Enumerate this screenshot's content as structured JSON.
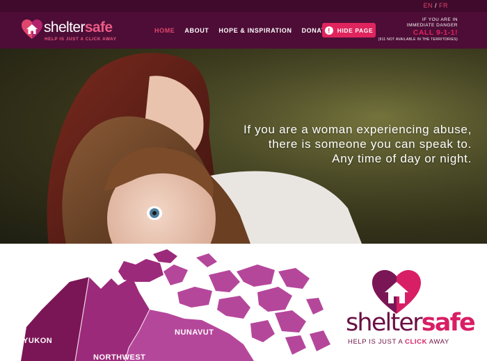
{
  "language": {
    "en": "EN",
    "separator": "/",
    "fr": "FR"
  },
  "brand": {
    "name_part1": "shelter",
    "name_part2": "safe",
    "tagline": "HELP IS JUST A CLICK AWAY",
    "big_tagline_part1": "HELP IS JUST A ",
    "big_tagline_click": "CLICK",
    "big_tagline_part2": " AWAY"
  },
  "nav": {
    "items": [
      {
        "label": "HOME",
        "active": true
      },
      {
        "label": "ABOUT",
        "active": false
      },
      {
        "label": "HOPE & INSPIRATION",
        "active": false
      },
      {
        "label": "DONATE",
        "active": false
      }
    ]
  },
  "hide_button": {
    "icon": "!",
    "label": "HIDE PAGE"
  },
  "danger": {
    "line1": "IF YOU ARE IN",
    "line2": "IMMEDIATE DANGER",
    "call": "CALL 9-1-1!",
    "note": "(911 NOT AVAILABLE IN THE TERRITORIES)"
  },
  "hero": {
    "line1": "If you are a woman experiencing abuse,",
    "line2": "there is someone you can speak to.",
    "line3": "Any time of day or night."
  },
  "map": {
    "regions": [
      "YUKON",
      "NORTHWEST",
      "NUNAVUT"
    ]
  },
  "colors": {
    "header_bg": "#4d0d36",
    "accent": "#e0245e",
    "map_dark": "#7a1656",
    "map_mid": "#9c2a7a",
    "map_light": "#b5479b"
  }
}
